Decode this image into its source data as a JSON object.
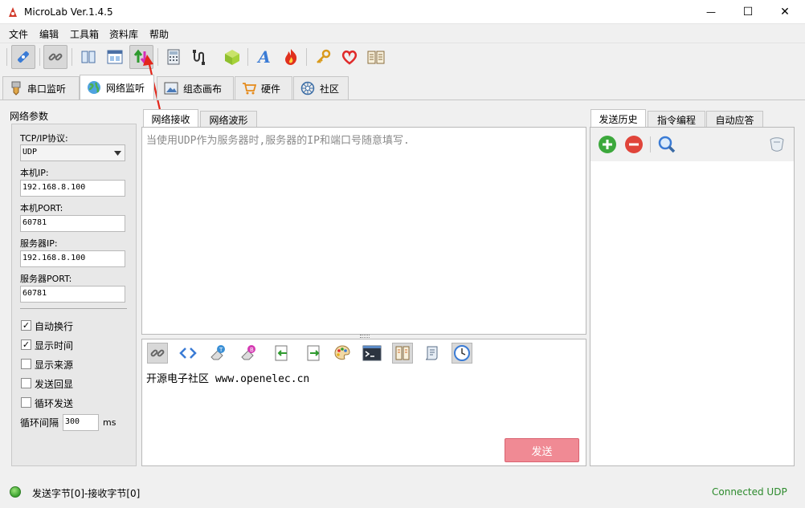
{
  "window": {
    "title": "MicroLab Ver.1.4.5",
    "minimize_glyph": "—",
    "maximize_glyph": "☐",
    "close_glyph": "✕"
  },
  "menu": [
    "文件",
    "编辑",
    "工具箱",
    "资料库",
    "帮助"
  ],
  "toolbar_icons": [
    "usb-connect-icon",
    "link-icon",
    "dual-panel-icon",
    "window-layout-icon",
    "up-down-transfer-icon",
    "calculator-icon",
    "signal-probe-icon",
    "cube-icon",
    "font-a-icon",
    "flame-icon",
    "key-icon",
    "heart-icon",
    "book-icon"
  ],
  "main_tabs": [
    "串口监听",
    "网络监听",
    "组态画布",
    "硬件",
    "社区"
  ],
  "left_panel": {
    "group_label": "网络参数",
    "protocol_label": "TCP/IP协议:",
    "protocol_value": "UDP",
    "local_ip_label": "本机IP:",
    "local_ip": "192.168.8.100",
    "local_port_label": "本机PORT:",
    "local_port": "60781",
    "server_ip_label": "服务器IP:",
    "server_ip": "192.168.8.100",
    "server_port_label": "服务器PORT:",
    "server_port": "60781",
    "checkboxes": [
      {
        "label": "自动换行",
        "checked": "✓"
      },
      {
        "label": "显示时间",
        "checked": "✓"
      },
      {
        "label": "显示来源",
        "checked": ""
      },
      {
        "label": "发送回显",
        "checked": ""
      },
      {
        "label": "循环发送",
        "checked": ""
      }
    ],
    "interval_label": "循环间隔",
    "interval_value": "300",
    "interval_unit": "ms"
  },
  "center": {
    "tabs": [
      "网络接收",
      "网络波形"
    ],
    "recv_hint": "当使用UDP作为服务器时,服务器的IP和端口号随意填写.",
    "send_icons": [
      "link-icon",
      "code-brackets-icon",
      "eraser-t-icon",
      "eraser-b-icon",
      "import-arrow-icon",
      "export-arrow-icon",
      "palette-icon",
      "terminal-icon",
      "panel-icon",
      "scroll-icon",
      "clock-icon"
    ],
    "send_text": "开源电子社区 www.openelec.cn",
    "send_button": "发送"
  },
  "right": {
    "tabs": [
      "发送历史",
      "指令编程",
      "自动应答"
    ]
  },
  "status": {
    "bytes": "发送字节[0]-接收字节[0]",
    "connection": "Connected UDP"
  }
}
